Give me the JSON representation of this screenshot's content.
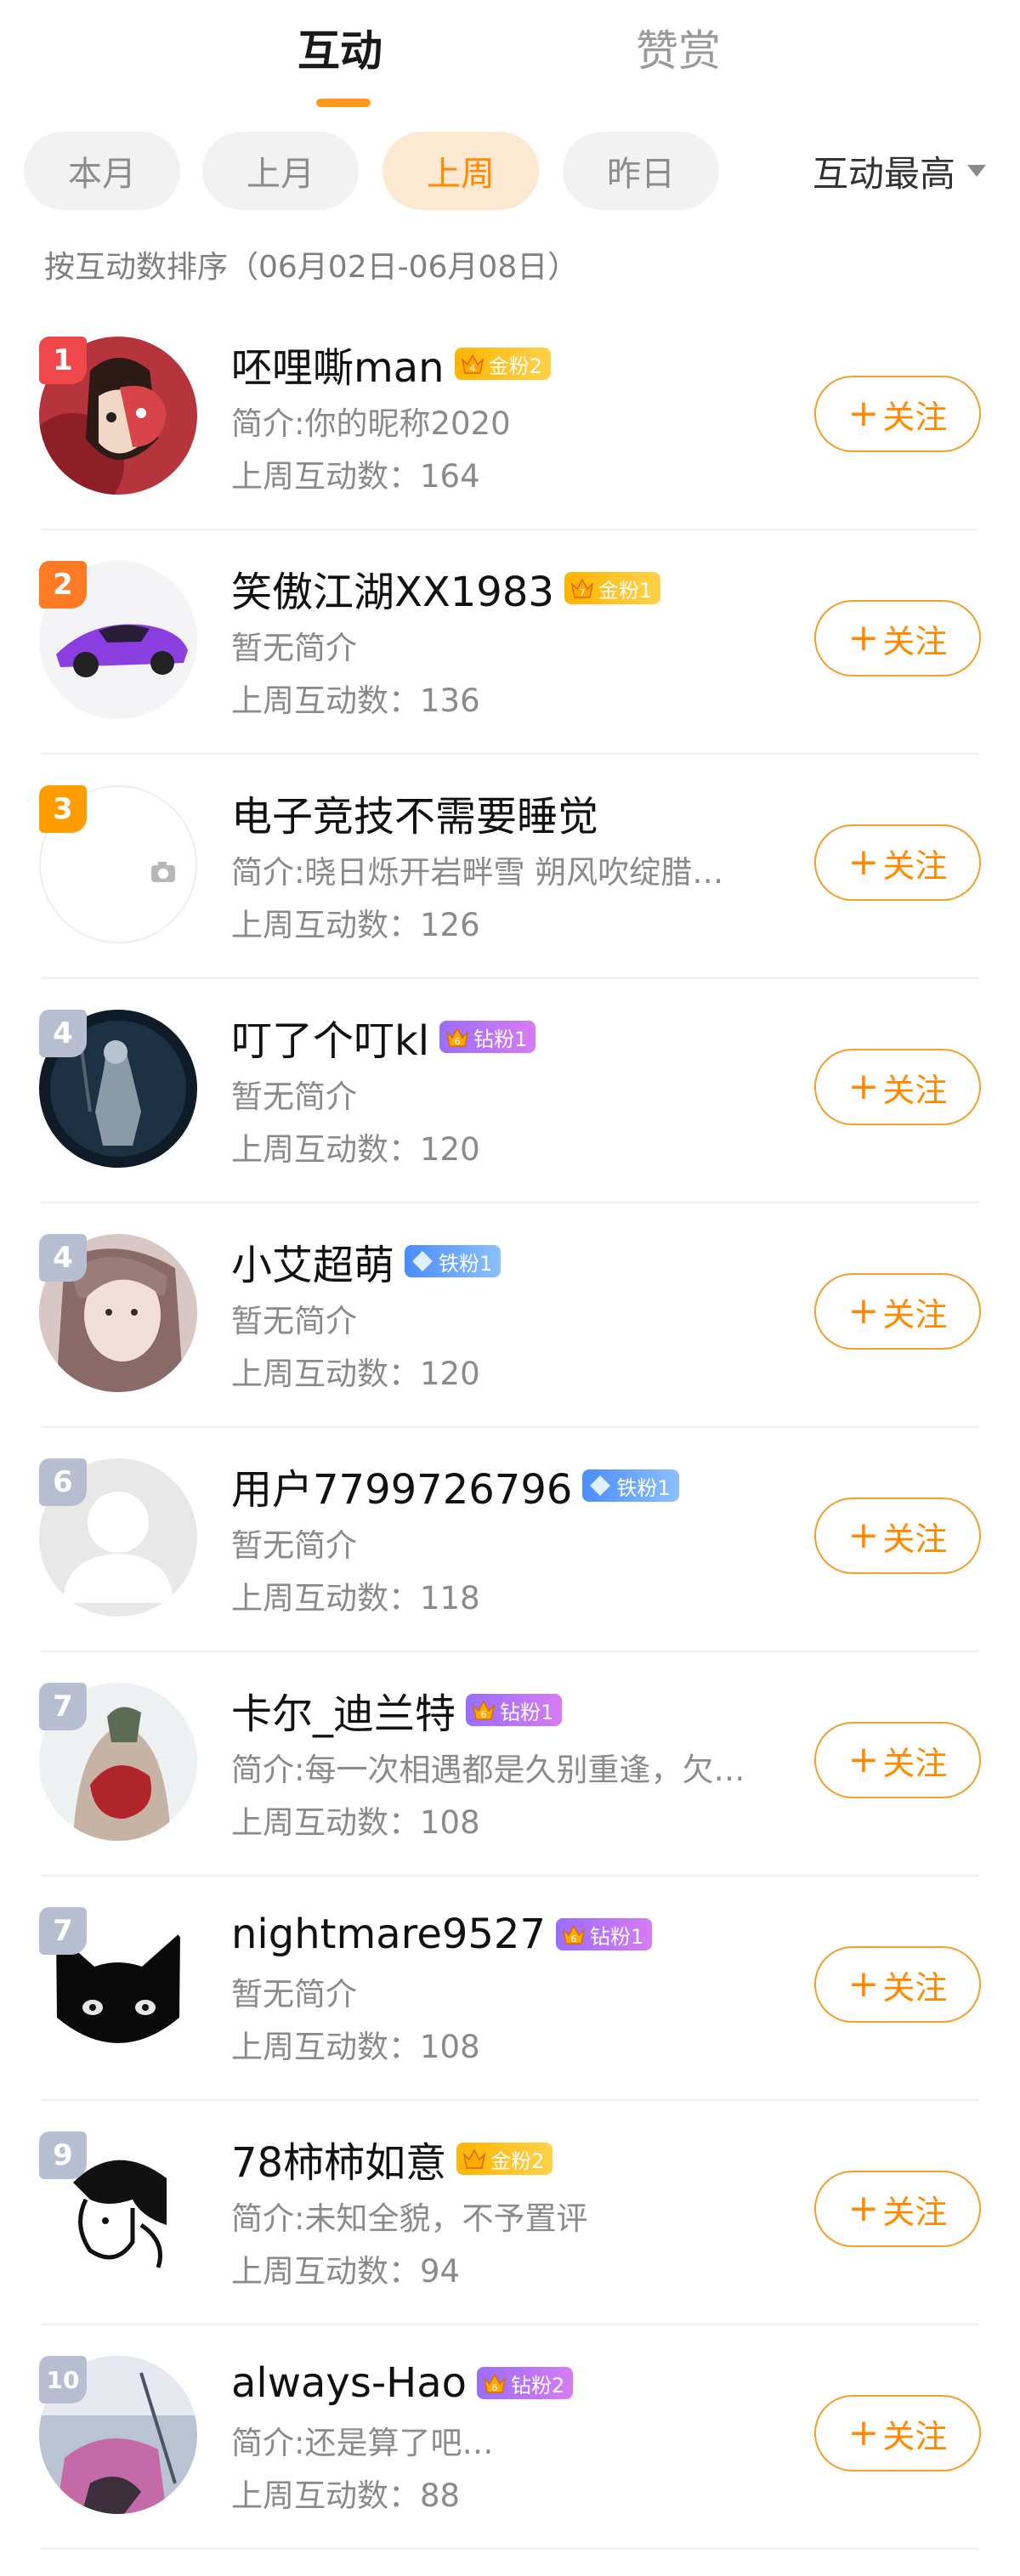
{
  "tabs": [
    "互动",
    "赞赏"
  ],
  "filters": [
    "本月",
    "上月",
    "上周",
    "昨日"
  ],
  "active_filter": 2,
  "sort_dropdown": "互动最高",
  "sort_note": "按互动数排序（06月02日-06月08日）",
  "follow_label": "关注",
  "count_prefix": "上周互动数：",
  "fans": [
    {
      "rank": "1",
      "name": "呸哩嘶man",
      "badge": {
        "type": "gold",
        "level": "4",
        "label": "金粉2"
      },
      "bio": "简介:你的昵称2020",
      "count": "164",
      "avatar": "anime-mask"
    },
    {
      "rank": "2",
      "name": "笑傲江湖XX1983",
      "badge": {
        "type": "gold",
        "level": "7",
        "label": "金粉1"
      },
      "bio": "暂无简介",
      "count": "136",
      "avatar": "purple-car"
    },
    {
      "rank": "3",
      "name": "电子竞技不需要睡觉",
      "badge": null,
      "bio": "简介:晓日烁开岩畔雪 朔风吹绽腊…",
      "count": "126",
      "avatar": "camera-placeholder"
    },
    {
      "rank": "4",
      "name": "叮了个叮kl",
      "badge": {
        "type": "diamond",
        "level": "6",
        "label": "钻粉1"
      },
      "bio": "暂无简介",
      "count": "120",
      "avatar": "dark-warrior"
    },
    {
      "rank": "4",
      "name": "小艾超萌",
      "badge": {
        "type": "iron",
        "level": "",
        "label": "铁粉1"
      },
      "bio": "暂无简介",
      "count": "120",
      "avatar": "girl-photo"
    },
    {
      "rank": "6",
      "name": "用户7799726796",
      "badge": {
        "type": "iron",
        "level": "",
        "label": "铁粉1"
      },
      "bio": "暂无简介",
      "count": "118",
      "avatar": "default-user"
    },
    {
      "rank": "7",
      "name": "卡尔_迪兰特",
      "badge": {
        "type": "diamond",
        "level": "6",
        "label": "钻粉1"
      },
      "bio": "简介:每一次相遇都是久别重逢，欠…",
      "count": "108",
      "avatar": "tattoo-back"
    },
    {
      "rank": "7",
      "name": "nightmare9527",
      "badge": {
        "type": "diamond",
        "level": "6",
        "label": "钻粉1"
      },
      "bio": "暂无简介",
      "count": "108",
      "avatar": "black-cat"
    },
    {
      "rank": "9",
      "name": "78柿柿如意",
      "badge": {
        "type": "gold",
        "level": "",
        "label": "金粉2"
      },
      "bio": "简介:未知全貌，不予置评",
      "count": "94",
      "avatar": "sketch-boy"
    },
    {
      "rank": "10",
      "name": "always-Hao",
      "badge": {
        "type": "diamond",
        "level": "6",
        "label": "钻粉2"
      },
      "bio": "简介:还是算了吧…",
      "count": "88",
      "avatar": "pink-doodle"
    }
  ]
}
